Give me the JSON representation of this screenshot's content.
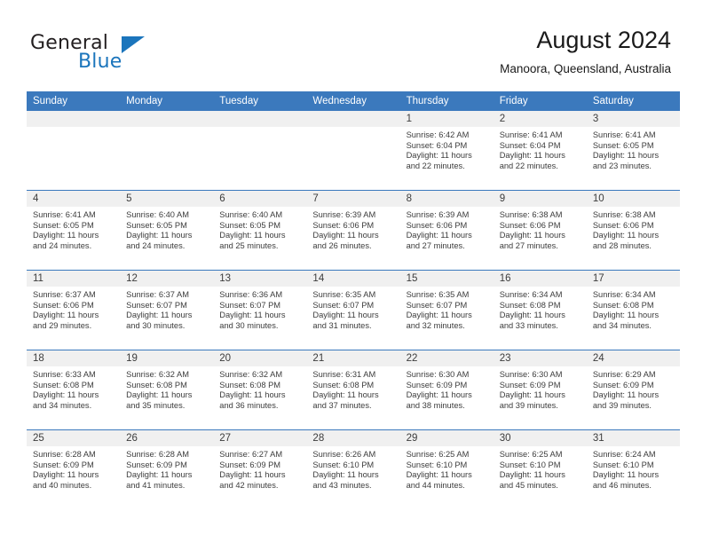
{
  "brand": {
    "name_part1": "General",
    "name_part2": "Blue",
    "triangle_icon": "blue-triangle-logo-icon",
    "accent_color": "#1b75bc"
  },
  "header": {
    "month_title": "August 2024",
    "location": "Manoora, Queensland, Australia"
  },
  "colors": {
    "header_row_bg": "#3b79bd",
    "day_number_bg": "#f0f0f0",
    "text": "#3c3c3c"
  },
  "weekdays": [
    "Sunday",
    "Monday",
    "Tuesday",
    "Wednesday",
    "Thursday",
    "Friday",
    "Saturday"
  ],
  "weeks": [
    [
      {
        "day": "",
        "empty": true,
        "sunrise": "",
        "sunset": "",
        "daylight_line1": "",
        "daylight_line2": ""
      },
      {
        "day": "",
        "empty": true,
        "sunrise": "",
        "sunset": "",
        "daylight_line1": "",
        "daylight_line2": ""
      },
      {
        "day": "",
        "empty": true,
        "sunrise": "",
        "sunset": "",
        "daylight_line1": "",
        "daylight_line2": ""
      },
      {
        "day": "",
        "empty": true,
        "sunrise": "",
        "sunset": "",
        "daylight_line1": "",
        "daylight_line2": ""
      },
      {
        "day": "1",
        "sunrise": "Sunrise: 6:42 AM",
        "sunset": "Sunset: 6:04 PM",
        "daylight_line1": "Daylight: 11 hours",
        "daylight_line2": "and 22 minutes."
      },
      {
        "day": "2",
        "sunrise": "Sunrise: 6:41 AM",
        "sunset": "Sunset: 6:04 PM",
        "daylight_line1": "Daylight: 11 hours",
        "daylight_line2": "and 22 minutes."
      },
      {
        "day": "3",
        "sunrise": "Sunrise: 6:41 AM",
        "sunset": "Sunset: 6:05 PM",
        "daylight_line1": "Daylight: 11 hours",
        "daylight_line2": "and 23 minutes."
      }
    ],
    [
      {
        "day": "4",
        "sunrise": "Sunrise: 6:41 AM",
        "sunset": "Sunset: 6:05 PM",
        "daylight_line1": "Daylight: 11 hours",
        "daylight_line2": "and 24 minutes."
      },
      {
        "day": "5",
        "sunrise": "Sunrise: 6:40 AM",
        "sunset": "Sunset: 6:05 PM",
        "daylight_line1": "Daylight: 11 hours",
        "daylight_line2": "and 24 minutes."
      },
      {
        "day": "6",
        "sunrise": "Sunrise: 6:40 AM",
        "sunset": "Sunset: 6:05 PM",
        "daylight_line1": "Daylight: 11 hours",
        "daylight_line2": "and 25 minutes."
      },
      {
        "day": "7",
        "sunrise": "Sunrise: 6:39 AM",
        "sunset": "Sunset: 6:06 PM",
        "daylight_line1": "Daylight: 11 hours",
        "daylight_line2": "and 26 minutes."
      },
      {
        "day": "8",
        "sunrise": "Sunrise: 6:39 AM",
        "sunset": "Sunset: 6:06 PM",
        "daylight_line1": "Daylight: 11 hours",
        "daylight_line2": "and 27 minutes."
      },
      {
        "day": "9",
        "sunrise": "Sunrise: 6:38 AM",
        "sunset": "Sunset: 6:06 PM",
        "daylight_line1": "Daylight: 11 hours",
        "daylight_line2": "and 27 minutes."
      },
      {
        "day": "10",
        "sunrise": "Sunrise: 6:38 AM",
        "sunset": "Sunset: 6:06 PM",
        "daylight_line1": "Daylight: 11 hours",
        "daylight_line2": "and 28 minutes."
      }
    ],
    [
      {
        "day": "11",
        "sunrise": "Sunrise: 6:37 AM",
        "sunset": "Sunset: 6:06 PM",
        "daylight_line1": "Daylight: 11 hours",
        "daylight_line2": "and 29 minutes."
      },
      {
        "day": "12",
        "sunrise": "Sunrise: 6:37 AM",
        "sunset": "Sunset: 6:07 PM",
        "daylight_line1": "Daylight: 11 hours",
        "daylight_line2": "and 30 minutes."
      },
      {
        "day": "13",
        "sunrise": "Sunrise: 6:36 AM",
        "sunset": "Sunset: 6:07 PM",
        "daylight_line1": "Daylight: 11 hours",
        "daylight_line2": "and 30 minutes."
      },
      {
        "day": "14",
        "sunrise": "Sunrise: 6:35 AM",
        "sunset": "Sunset: 6:07 PM",
        "daylight_line1": "Daylight: 11 hours",
        "daylight_line2": "and 31 minutes."
      },
      {
        "day": "15",
        "sunrise": "Sunrise: 6:35 AM",
        "sunset": "Sunset: 6:07 PM",
        "daylight_line1": "Daylight: 11 hours",
        "daylight_line2": "and 32 minutes."
      },
      {
        "day": "16",
        "sunrise": "Sunrise: 6:34 AM",
        "sunset": "Sunset: 6:08 PM",
        "daylight_line1": "Daylight: 11 hours",
        "daylight_line2": "and 33 minutes."
      },
      {
        "day": "17",
        "sunrise": "Sunrise: 6:34 AM",
        "sunset": "Sunset: 6:08 PM",
        "daylight_line1": "Daylight: 11 hours",
        "daylight_line2": "and 34 minutes."
      }
    ],
    [
      {
        "day": "18",
        "sunrise": "Sunrise: 6:33 AM",
        "sunset": "Sunset: 6:08 PM",
        "daylight_line1": "Daylight: 11 hours",
        "daylight_line2": "and 34 minutes."
      },
      {
        "day": "19",
        "sunrise": "Sunrise: 6:32 AM",
        "sunset": "Sunset: 6:08 PM",
        "daylight_line1": "Daylight: 11 hours",
        "daylight_line2": "and 35 minutes."
      },
      {
        "day": "20",
        "sunrise": "Sunrise: 6:32 AM",
        "sunset": "Sunset: 6:08 PM",
        "daylight_line1": "Daylight: 11 hours",
        "daylight_line2": "and 36 minutes."
      },
      {
        "day": "21",
        "sunrise": "Sunrise: 6:31 AM",
        "sunset": "Sunset: 6:08 PM",
        "daylight_line1": "Daylight: 11 hours",
        "daylight_line2": "and 37 minutes."
      },
      {
        "day": "22",
        "sunrise": "Sunrise: 6:30 AM",
        "sunset": "Sunset: 6:09 PM",
        "daylight_line1": "Daylight: 11 hours",
        "daylight_line2": "and 38 minutes."
      },
      {
        "day": "23",
        "sunrise": "Sunrise: 6:30 AM",
        "sunset": "Sunset: 6:09 PM",
        "daylight_line1": "Daylight: 11 hours",
        "daylight_line2": "and 39 minutes."
      },
      {
        "day": "24",
        "sunrise": "Sunrise: 6:29 AM",
        "sunset": "Sunset: 6:09 PM",
        "daylight_line1": "Daylight: 11 hours",
        "daylight_line2": "and 39 minutes."
      }
    ],
    [
      {
        "day": "25",
        "sunrise": "Sunrise: 6:28 AM",
        "sunset": "Sunset: 6:09 PM",
        "daylight_line1": "Daylight: 11 hours",
        "daylight_line2": "and 40 minutes."
      },
      {
        "day": "26",
        "sunrise": "Sunrise: 6:28 AM",
        "sunset": "Sunset: 6:09 PM",
        "daylight_line1": "Daylight: 11 hours",
        "daylight_line2": "and 41 minutes."
      },
      {
        "day": "27",
        "sunrise": "Sunrise: 6:27 AM",
        "sunset": "Sunset: 6:09 PM",
        "daylight_line1": "Daylight: 11 hours",
        "daylight_line2": "and 42 minutes."
      },
      {
        "day": "28",
        "sunrise": "Sunrise: 6:26 AM",
        "sunset": "Sunset: 6:10 PM",
        "daylight_line1": "Daylight: 11 hours",
        "daylight_line2": "and 43 minutes."
      },
      {
        "day": "29",
        "sunrise": "Sunrise: 6:25 AM",
        "sunset": "Sunset: 6:10 PM",
        "daylight_line1": "Daylight: 11 hours",
        "daylight_line2": "and 44 minutes."
      },
      {
        "day": "30",
        "sunrise": "Sunrise: 6:25 AM",
        "sunset": "Sunset: 6:10 PM",
        "daylight_line1": "Daylight: 11 hours",
        "daylight_line2": "and 45 minutes."
      },
      {
        "day": "31",
        "sunrise": "Sunrise: 6:24 AM",
        "sunset": "Sunset: 6:10 PM",
        "daylight_line1": "Daylight: 11 hours",
        "daylight_line2": "and 46 minutes."
      }
    ]
  ]
}
